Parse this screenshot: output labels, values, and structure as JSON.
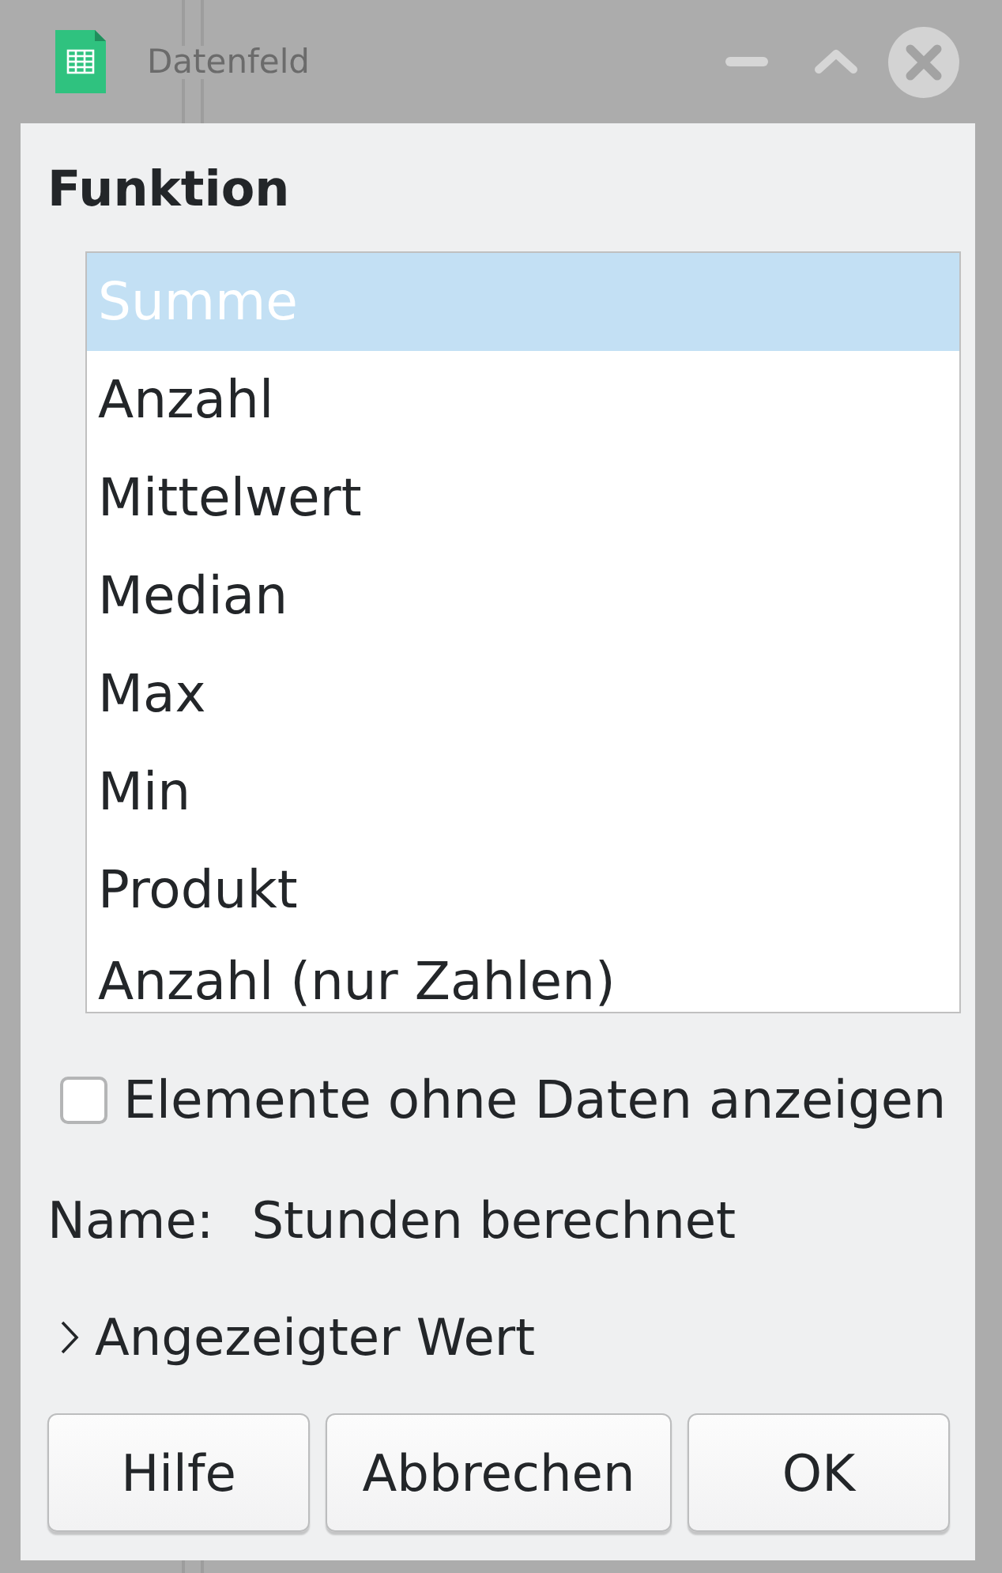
{
  "window": {
    "title": "Datenfeld"
  },
  "function": {
    "heading": "Funktion",
    "items": [
      {
        "label": "Summe",
        "selected": true
      },
      {
        "label": "Anzahl",
        "selected": false
      },
      {
        "label": "Mittelwert",
        "selected": false
      },
      {
        "label": "Median",
        "selected": false
      },
      {
        "label": "Max",
        "selected": false
      },
      {
        "label": "Min",
        "selected": false
      },
      {
        "label": "Produkt",
        "selected": false
      },
      {
        "label": "Anzahl (nur Zahlen)",
        "selected": false
      }
    ]
  },
  "show_items_without_data": {
    "label": "Elemente ohne Daten anzeigen",
    "checked": false
  },
  "name": {
    "label": "Name:",
    "value": "Stunden berechnet"
  },
  "displayed_value": {
    "label": "Angezeigter Wert",
    "expanded": false
  },
  "buttons": [
    "Hilfe",
    "Abbrechen",
    "OK"
  ]
}
